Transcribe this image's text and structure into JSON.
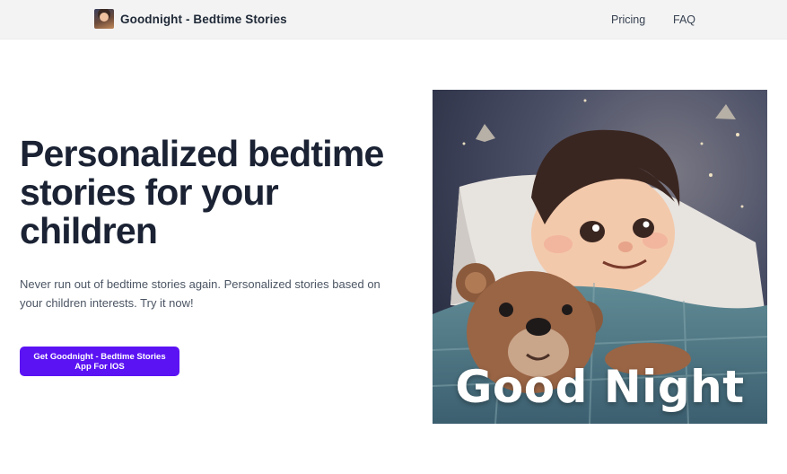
{
  "header": {
    "brand_name": "Goodnight - Bedtime Stories",
    "brand_logo_icon": "app-logo-icon",
    "nav": {
      "pricing_label": "Pricing",
      "faq_label": "FAQ"
    }
  },
  "hero": {
    "title": "Personalized bedtime stories for your children",
    "description": "Never run out of bedtime stories again. Personalized stories based on your children interests. Try it now!",
    "cta_label": "Get Goodnight - Bedtime Stories App For IOS",
    "image": {
      "caption": "Good Night",
      "subject": "boy-sleeping-with-teddy-bear-illustration"
    }
  },
  "colors": {
    "header_bg": "#f3f3f3",
    "title_text": "#1a2233",
    "body_text": "#4b5563",
    "cta_bg": "#5b13f3",
    "cta_text": "#ffffff"
  }
}
